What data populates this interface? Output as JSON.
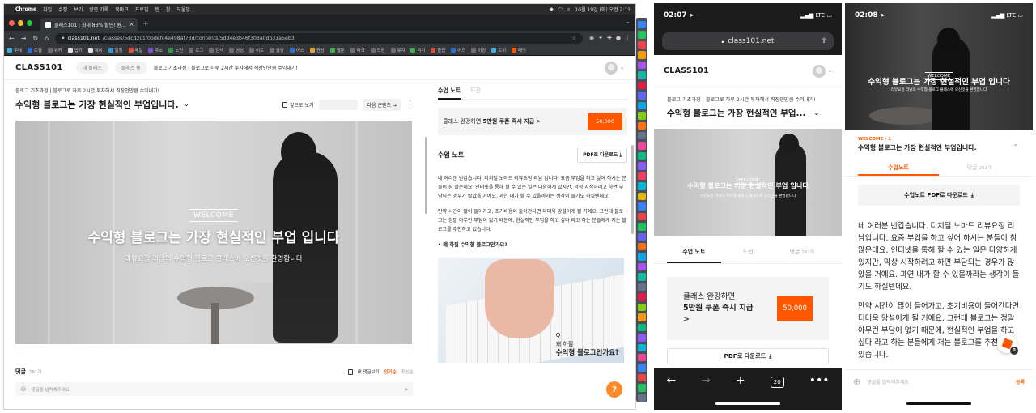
{
  "mac": {
    "menu_items": [
      "Chrome",
      "파일",
      "수정",
      "보기",
      "방문 기록",
      "북마크",
      "프로필",
      "탭",
      "창",
      "도움말"
    ],
    "clock": "10월 19일 (화) 오전 2:11"
  },
  "browser": {
    "tab_title": "클래스101 | 최대 83% 할인! 원...",
    "url_host": "class101.net",
    "url_path": "/classes/5dcd2c1f0bdefc4e498af73d/contents/5dd4e3b46f303a0db31a5eb3",
    "bookmarks": [
      {
        "label": "두레",
        "color": "#3ab0e6"
      },
      {
        "label": "트렐",
        "color": "#2d6fd8"
      },
      {
        "label": "위키",
        "color": "#6f6f6f"
      },
      {
        "label": "앱키",
        "color": "#e0e0e0"
      },
      {
        "label": "제이",
        "color": "#e0e0e0"
      },
      {
        "label": "일정",
        "color": "#2d9bd8"
      },
      {
        "label": "메일",
        "color": "#e14d3d"
      },
      {
        "label": "주소",
        "color": "#7b52d6"
      },
      {
        "label": "노란",
        "color": "#2f9a4a"
      },
      {
        "label": "로그",
        "color": "#6f6f6f"
      },
      {
        "label": "검색",
        "color": "#6f6f6f"
      },
      {
        "label": "영상",
        "color": "#6f6f6f"
      },
      {
        "label": "이트",
        "color": "#6f6f6f"
      },
      {
        "label": "쿨랑",
        "color": "#6f6f6f"
      },
      {
        "label": "어스",
        "color": "#2d6fd8"
      },
      {
        "label": "원상",
        "color": "#e8a021"
      },
      {
        "label": "웹툰",
        "color": "#38b34a"
      },
      {
        "label": "라크",
        "color": "#6f6f6f"
      },
      {
        "label": "드림",
        "color": "#6f6f6f"
      },
      {
        "label": "뮤지",
        "color": "#6f6f6f"
      },
      {
        "label": "리디",
        "color": "#38b34a"
      },
      {
        "label": "폴립",
        "color": "#e14d3d"
      },
      {
        "label": "어드",
        "color": "#2d6fd8"
      },
      {
        "label": "이밍",
        "color": "#6f6f6f"
      },
      {
        "label": "트위",
        "color": "#3ab0e6"
      },
      {
        "label": "레딧",
        "color": "#ff5600"
      }
    ]
  },
  "site": {
    "logo": "CLASS101",
    "nav_my_class": "내 클래스",
    "nav_class_home": "클래스 홈",
    "breadcrumb": "블로그 기초과정 | 블로그로 하루 2시간 투자해서 직장인만큼 수익내기!",
    "course_subtitle": "블로그 기초과정 | 블로그로 하루 2시간 투자해서 직장인만큼 수익내기!",
    "lesson_title": "수익형 블로그는 가장 현실적인 부업입니다.",
    "wide_view": "앞으로 보기",
    "next_content": "다음 콘텐츠",
    "video_tag": "WELCOME",
    "video_title": "수익형 블로그는 가장 현실적인 부업 입니다",
    "video_subtitle": "리뷰요정 리남의 수익형 블로그 클래스에 오신것을 환영합니다",
    "comments_label": "댓글",
    "comments_count": "261개",
    "my_comments": "내 댓글보기",
    "sort_popular": "인기순",
    "sort_recent": "최신순",
    "comment_placeholder": "댓글을 입력해주세요.",
    "help": "?"
  },
  "panel": {
    "tab_notes": "수업 노트",
    "tab_challenge": "도전",
    "coupon_text": "클래스 완강하면",
    "coupon_bold": "5만원 쿠폰 즉시 지급",
    "coupon_arrow": ">",
    "coupon_amount": "50,000",
    "notes_heading": "수업 노트",
    "pdf_download": "PDF로 다운로드",
    "para1": "네 여러분 반갑습니다. 디지털 노마드 리뷰요정 리남 입니다. 요즘 부업을 하고 싶어 하시는 분들이 참 많은데요. 인터넷을 통해 할 수 있는 일은 다양하게 있지만, 막상 시작하려고 하면 부담되는 경우가 많았을 거예요. 과연 내가 할 수 있을까라는 생각이 들기도 하실텐데요.",
    "para2": "만약 시간이 많이 들어가고, 초기비용이 들어간다면 더더욱 망설이게 될 거예요. 그런데 블로그는 정말 아무런 부담이 없기 때문에, 현실적인 부업을 하고 싶다 라고 하는 분들에게 저는 블로그를 추천하고 있습니다.",
    "bullet": "• 왜 하필 수익형 블로그인가요?",
    "img_line1": "Q",
    "img_line2": "왜 하필",
    "img_line3": "수익형 블로그인가요?"
  },
  "phone1": {
    "time": "02:07",
    "signal": "LTE",
    "url": "class101.net",
    "logo": "CLASS101",
    "sub": "블로그 기초과정 | 블로그로 하루 2시간 투자해서 직장인만큼 수익내기!",
    "title": "수익형 블로그는 가장 현실적인 부업...",
    "video_tag": "WELCOME",
    "video_title": "수익형 블로그는 가장 현실적인 부업 입니다",
    "video_subtitle": "리뷰요정 리남의 수익형 블로그 클래스에 오신것을 환영합니다",
    "tab_notes": "수업 노트",
    "tab_challenge": "도전",
    "tab_comments": "댓글",
    "tab_comments_count": "261개",
    "coupon_line1": "클래스 완강하면",
    "coupon_line2": "5만원 쿠폰 즉시 지급",
    "coupon_arrow": ">",
    "coupon_amount": "50,000",
    "pdf": "PDF로 다운로드",
    "tab_count": "20"
  },
  "phone2": {
    "time": "02:08",
    "signal": "LTE",
    "video_tag": "WELCOME",
    "video_title": "수익형 블로그는 가장 현실적인 부업 입니다",
    "video_subtitle": "리뷰요정 리남의 수익형 블로그 클래스에 오신것을 환영합니다",
    "lesson_label": "WELCOME - 1",
    "lesson_title": "수익형 블로그는 가장 현실적인 부업입니다.",
    "tab_notes": "수업노트",
    "tab_comments": "댓글",
    "tab_comments_count": "261개",
    "pdf": "수업노트 PDF로 다운로드",
    "para1": "네 여러분 반갑습니다. 디지털 노마드 리뷰요정 리남입니다. 요즘 부업을 하고 싶어 하시는 분들이 참 많은데요. 인터넷을 통해 할 수 있는 일은 다양하게 있지만, 막상 시작하려고 하면 부담되는 경우가 많았을 거예요. 과연 내가 할 수 있을까라는 생각이 들기도 하실텐데요.",
    "para2": "만약 시간이 많이 들어가고, 초기비용이 들어간다면 더더욱 망설이게 될 거예요. 그런데 블로그는 정말 아무런 부담이 없기 때문에, 현실적인 부업을 하고 싶다 라고 하는 분들에게 저는 블로그를 추천하고 있습니다.",
    "fab_badge": "0",
    "comment_placeholder": "댓글을 입력해주세요",
    "post": "등록"
  },
  "colors": {
    "accent": "#ff5600",
    "dock_icons": [
      "#3b82f6",
      "#22c55e",
      "#ef4444",
      "#f59e0b",
      "#a855f7",
      "#14b8a6",
      "#e11d48",
      "#6366f1",
      "#0ea5e9",
      "#84cc16",
      "#f97316",
      "#64748b",
      "#ec4899",
      "#10b981",
      "#8b5cf6",
      "#f43f5e",
      "#06b6d4",
      "#eab308",
      "#3b82f6",
      "#ef4444",
      "#22c55e",
      "#6366f1",
      "#f97316",
      "#0ea5e9",
      "#a855f7",
      "#14b8a6",
      "#64748b",
      "#e11d48",
      "#84cc16",
      "#f59e0b",
      "#10b981",
      "#8b5cf6",
      "#06b6d4",
      "#ec4899",
      "#3b82f6",
      "#ef4444",
      "#22c55e",
      "#64748b"
    ]
  }
}
